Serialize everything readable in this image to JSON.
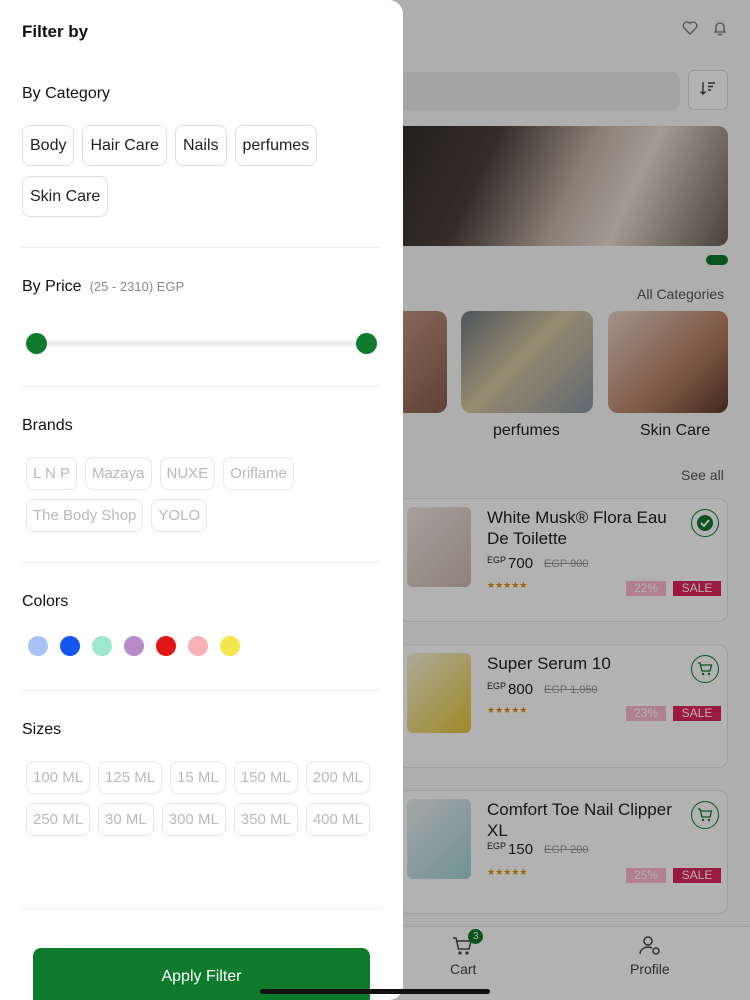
{
  "app": {
    "all_categories": "All Categories",
    "see_all": "See all",
    "categories": [
      {
        "label": "perfumes"
      },
      {
        "label": "Skin Care"
      }
    ],
    "products": [
      {
        "name": "White Musk® Flora Eau De Toilette",
        "currency": "EGP",
        "price": "700",
        "old_price": "EGP 900",
        "discount": "22%",
        "sale": "SALE",
        "stars": "★★★★★",
        "action": "in-cart-check-icon"
      },
      {
        "name": "Super Serum 10",
        "currency": "EGP",
        "price": "800",
        "old_price": "EGP 1,050",
        "discount": "23%",
        "sale": "SALE",
        "stars": "★★★★★",
        "action": "add-to-cart-icon"
      },
      {
        "name": "Comfort Toe Nail Clipper XL",
        "currency": "EGP",
        "price": "150",
        "old_price": "EGP 200",
        "discount": "25%",
        "sale": "SALE",
        "stars": "★★★★★",
        "action": "add-to-cart-icon"
      }
    ],
    "tabbar": {
      "cart": {
        "label": "Cart",
        "badge": "3"
      },
      "profile": {
        "label": "Profile"
      }
    }
  },
  "filter": {
    "title": "Filter by",
    "category": {
      "title": "By Category",
      "options": [
        "Body",
        "Hair Care",
        "Nails",
        "perfumes",
        "Skin Care"
      ]
    },
    "price": {
      "title": "By Price",
      "range_text": "(25 - 2310) EGP",
      "min": 25,
      "max": 2310,
      "selected_min": 25,
      "selected_max": 2310
    },
    "brands": {
      "title": "Brands",
      "options": [
        "L N P",
        "Mazaya",
        "NUXE",
        "Oriflame",
        "The Body Shop",
        "YOLO"
      ]
    },
    "colors": {
      "title": "Colors",
      "options": [
        "#a9c2f5",
        "#1555f0",
        "#9ee8cf",
        "#b98ac9",
        "#e21515",
        "#f7b3b8",
        "#f2e64a"
      ]
    },
    "sizes": {
      "title": "Sizes",
      "options": [
        "100 ML",
        "125 ML",
        "15 ML",
        "150 ML",
        "200 ML",
        "250 ML",
        "30 ML",
        "300 ML",
        "350 ML",
        "400 ML"
      ]
    },
    "apply_label": "Apply Filter"
  },
  "colors": {
    "accent": "#0d7a2c",
    "sale": "#e0245e",
    "discount": "#ffb6cf"
  }
}
